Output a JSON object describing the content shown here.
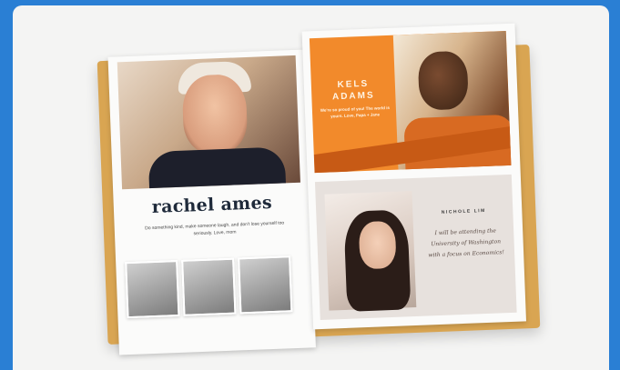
{
  "left_page": {
    "name": "rachel ames",
    "caption": "Do something kind, make someone laugh, and don't lose yourself too seriously. Love, mom"
  },
  "right_page": {
    "kels": {
      "name_line1": "KELS",
      "name_line2": "ADAMS",
      "message": "We're so proud of you! The world is yours. Love, Papa + Jane"
    },
    "nichole": {
      "name": "NICHOLE LIM",
      "message": "I will be attending the University of Washington with a focus on Economics!"
    }
  },
  "colors": {
    "background": "#2a7fd4",
    "cover": "#d9a552",
    "accent_orange": "#f28a2b",
    "title_navy": "#1f2a3a"
  }
}
